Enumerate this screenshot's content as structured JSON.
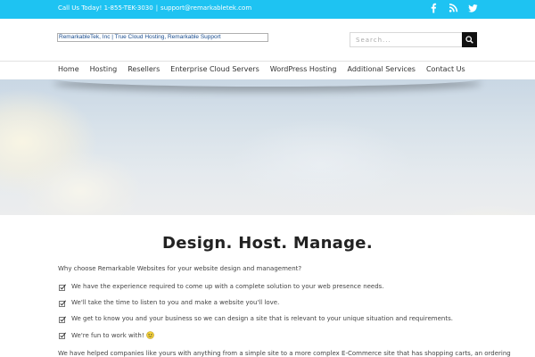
{
  "topbar": {
    "phone_text": "Call Us Today! 1-855-TEK-3030",
    "separator": "|",
    "email": "support@remarkabletek.com",
    "social_icons": [
      "facebook-icon",
      "rss-icon",
      "twitter-icon"
    ],
    "background_color": "#1ec3f2"
  },
  "header": {
    "logo_alt": "RemarkableTek, Inc | True Cloud Hosting, Remarkable Support",
    "search_placeholder": "Search..."
  },
  "nav": {
    "items": [
      "Home",
      "Hosting",
      "Resellers",
      "Enterprise Cloud Servers",
      "WordPress Hosting",
      "Additional Services",
      "Contact Us"
    ]
  },
  "main": {
    "headline": "Design. Host. Manage.",
    "intro": "Why choose Remarkable Websites for your website design and management?",
    "checklist": [
      "We have the experience required to come up with a complete solution to your web presence needs.",
      "We'll take the time to listen to you and make a website you'll love.",
      "We get to know you and your business so we can design a site that is relevant to your unique situation and requirements.",
      "We're fun to work with!"
    ],
    "closing": "We have helped companies like yours with anything from a simple site to a more complex E-Commerce site that has shopping carts, an ordering"
  }
}
